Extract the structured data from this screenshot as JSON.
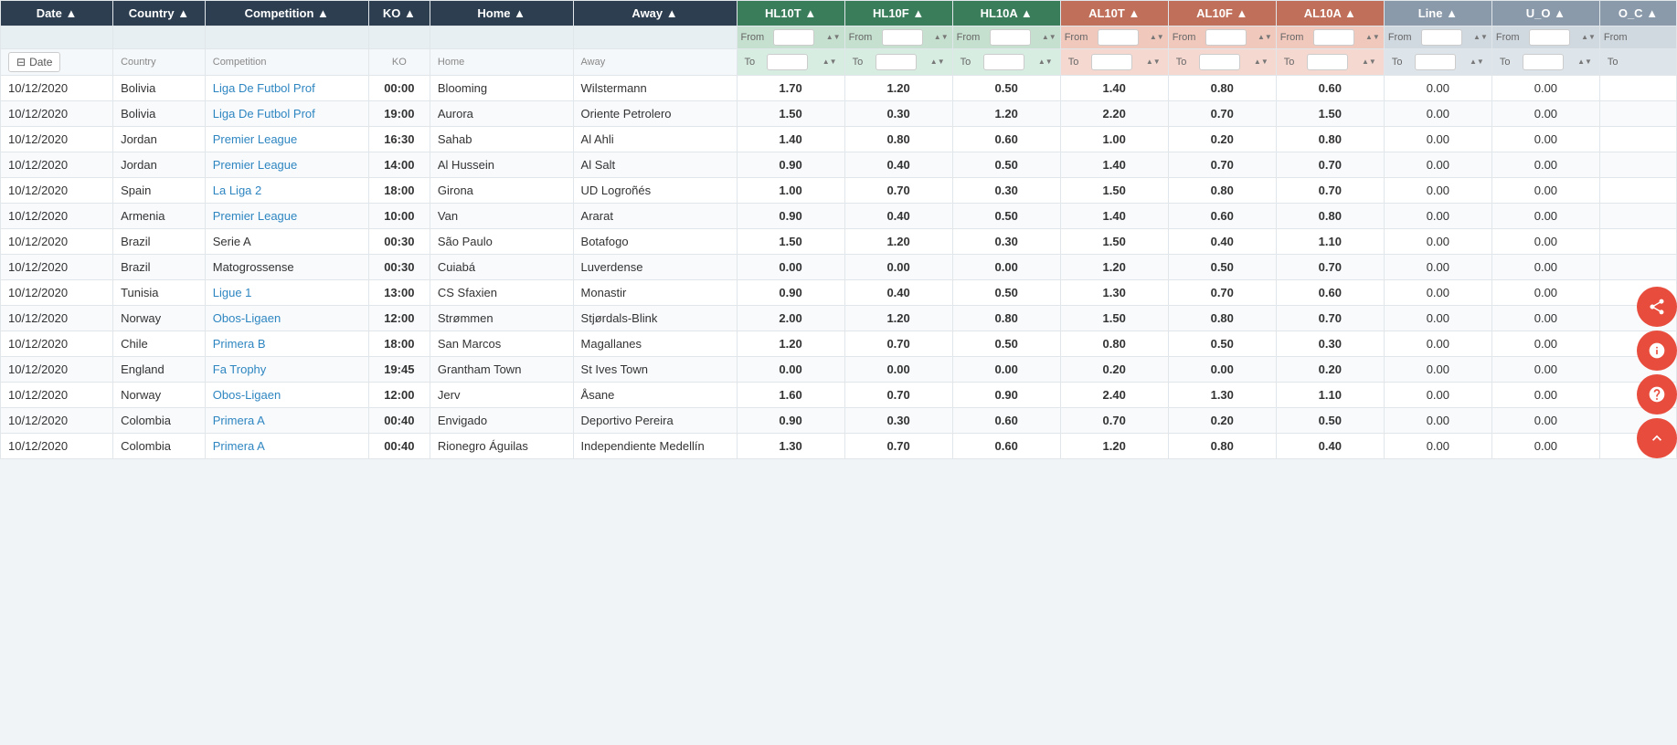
{
  "columns": {
    "date": "Date",
    "country": "Country",
    "competition": "Competition",
    "ko": "KO",
    "home": "Home",
    "away": "Away",
    "hl10t": "HL10T",
    "hl10f": "HL10F",
    "hl10a": "HL10A",
    "al10t": "AL10T",
    "al10f": "AL10F",
    "al10a": "AL10A",
    "line": "Line",
    "uo": "U_O",
    "oc": "O_C"
  },
  "filter_row": {
    "date_btn": "Date",
    "country_lbl": "Country",
    "competition_lbl": "Competition",
    "ko_lbl": "KO",
    "home_lbl": "Home",
    "away_lbl": "Away"
  },
  "from_label": "From",
  "to_label": "To",
  "rows": [
    {
      "date": "10/12/2020",
      "country": "Bolivia",
      "competition": "Liga De Futbol Prof",
      "competition_link": true,
      "ko": "00:00",
      "home": "Blooming",
      "away": "Wilstermann",
      "hl10t": "1.70",
      "hl10f": "1.20",
      "hl10a": "0.50",
      "al10t": "1.40",
      "al10f": "0.80",
      "al10a": "0.60",
      "line": "0.00",
      "uo": "0.00",
      "oc": "",
      "hl10t_class": "hl-dark",
      "hl10f_class": "hl-mid",
      "hl10a_class": "hl-vlight",
      "al10t_class": "al-light",
      "al10f_class": "al-vlight",
      "al10a_class": "al-zero"
    },
    {
      "date": "10/12/2020",
      "country": "Bolivia",
      "competition": "Liga De Futbol Prof",
      "competition_link": true,
      "ko": "19:00",
      "home": "Aurora",
      "away": "Oriente Petrolero",
      "hl10t": "1.50",
      "hl10f": "0.30",
      "hl10a": "1.20",
      "al10t": "2.20",
      "al10f": "0.70",
      "al10a": "1.50",
      "line": "0.00",
      "uo": "0.00",
      "oc": "",
      "hl10t_class": "hl-mid",
      "hl10f_class": "hl-vlight",
      "hl10a_class": "hl-mid",
      "al10t_class": "al-dark",
      "al10f_class": "al-vlight",
      "al10a_class": "al-mid"
    },
    {
      "date": "10/12/2020",
      "country": "Jordan",
      "competition": "Premier League",
      "competition_link": true,
      "ko": "16:30",
      "home": "Sahab",
      "away": "Al Ahli",
      "hl10t": "1.40",
      "hl10f": "0.80",
      "hl10a": "0.60",
      "al10t": "1.00",
      "al10f": "0.20",
      "al10a": "0.80",
      "line": "0.00",
      "uo": "0.00",
      "oc": "",
      "hl10t_class": "hl-light",
      "hl10f_class": "hl-vlight",
      "hl10a_class": "hl-vlight",
      "al10t_class": "al-vlight",
      "al10f_class": "al-zero",
      "al10a_class": "al-vlight"
    },
    {
      "date": "10/12/2020",
      "country": "Jordan",
      "competition": "Premier League",
      "competition_link": true,
      "ko": "14:00",
      "home": "Al Hussein",
      "away": "Al Salt",
      "hl10t": "0.90",
      "hl10f": "0.40",
      "hl10a": "0.50",
      "al10t": "1.40",
      "al10f": "0.70",
      "al10a": "0.70",
      "line": "0.00",
      "uo": "0.00",
      "oc": "",
      "hl10t_class": "hl-vlight",
      "hl10f_class": "hl-vlight",
      "hl10a_class": "hl-vlight",
      "al10t_class": "al-light",
      "al10f_class": "al-vlight",
      "al10a_class": "al-vlight"
    },
    {
      "date": "10/12/2020",
      "country": "Spain",
      "competition": "La Liga 2",
      "competition_link": true,
      "ko": "18:00",
      "home": "Girona",
      "away": "UD Logroñés",
      "hl10t": "1.00",
      "hl10f": "0.70",
      "hl10a": "0.30",
      "al10t": "1.50",
      "al10f": "0.80",
      "al10a": "0.70",
      "line": "0.00",
      "uo": "0.00",
      "oc": "",
      "hl10t_class": "hl-vlight",
      "hl10f_class": "hl-vlight",
      "hl10a_class": "hl-vlight",
      "al10t_class": "al-light",
      "al10f_class": "al-vlight",
      "al10a_class": "al-vlight"
    },
    {
      "date": "10/12/2020",
      "country": "Armenia",
      "competition": "Premier League",
      "competition_link": true,
      "ko": "10:00",
      "home": "Van",
      "away": "Ararat",
      "hl10t": "0.90",
      "hl10f": "0.40",
      "hl10a": "0.50",
      "al10t": "1.40",
      "al10f": "0.60",
      "al10a": "0.80",
      "line": "0.00",
      "uo": "0.00",
      "oc": "",
      "hl10t_class": "hl-vlight",
      "hl10f_class": "hl-vlight",
      "hl10a_class": "hl-vlight",
      "al10t_class": "al-light",
      "al10f_class": "al-vlight",
      "al10a_class": "al-vlight"
    },
    {
      "date": "10/12/2020",
      "country": "Brazil",
      "competition": "Serie A",
      "competition_link": false,
      "ko": "00:30",
      "home": "São Paulo",
      "away": "Botafogo",
      "hl10t": "1.50",
      "hl10f": "1.20",
      "hl10a": "0.30",
      "al10t": "1.50",
      "al10f": "0.40",
      "al10a": "1.10",
      "line": "0.00",
      "uo": "0.00",
      "oc": "",
      "hl10t_class": "hl-mid",
      "hl10f_class": "hl-mid",
      "hl10a_class": "hl-vlight",
      "al10t_class": "al-light",
      "al10f_class": "al-vlight",
      "al10a_class": "al-light"
    },
    {
      "date": "10/12/2020",
      "country": "Brazil",
      "competition": "Matogrossense",
      "competition_link": false,
      "ko": "00:30",
      "home": "Cuiabá",
      "away": "Luverdense",
      "hl10t": "0.00",
      "hl10f": "0.00",
      "hl10a": "0.00",
      "al10t": "1.20",
      "al10f": "0.50",
      "al10a": "0.70",
      "line": "0.00",
      "uo": "0.00",
      "oc": "",
      "hl10t_class": "hl-zero",
      "hl10f_class": "hl-zero",
      "hl10a_class": "hl-zero",
      "al10t_class": "al-vlight",
      "al10f_class": "al-vlight",
      "al10a_class": "al-vlight"
    },
    {
      "date": "10/12/2020",
      "country": "Tunisia",
      "competition": "Ligue 1",
      "competition_link": true,
      "ko": "13:00",
      "home": "CS Sfaxien",
      "away": "Monastir",
      "hl10t": "0.90",
      "hl10f": "0.40",
      "hl10a": "0.50",
      "al10t": "1.30",
      "al10f": "0.70",
      "al10a": "0.60",
      "line": "0.00",
      "uo": "0.00",
      "oc": "",
      "hl10t_class": "hl-vlight",
      "hl10f_class": "hl-vlight",
      "hl10a_class": "hl-vlight",
      "al10t_class": "al-light",
      "al10f_class": "al-vlight",
      "al10a_class": "al-vlight"
    },
    {
      "date": "10/12/2020",
      "country": "Norway",
      "competition": "Obos-Ligaen",
      "competition_link": true,
      "ko": "12:00",
      "home": "Strømmen",
      "away": "Stjørdals-Blink",
      "hl10t": "2.00",
      "hl10f": "1.20",
      "hl10a": "0.80",
      "al10t": "1.50",
      "al10f": "0.80",
      "al10a": "0.70",
      "line": "0.00",
      "uo": "0.00",
      "oc": "",
      "hl10t_class": "hl-dark",
      "hl10f_class": "hl-mid",
      "hl10a_class": "hl-vlight",
      "al10t_class": "al-light",
      "al10f_class": "al-vlight",
      "al10a_class": "al-vlight"
    },
    {
      "date": "10/12/2020",
      "country": "Chile",
      "competition": "Primera B",
      "competition_link": true,
      "ko": "18:00",
      "home": "San Marcos",
      "away": "Magallanes",
      "hl10t": "1.20",
      "hl10f": "0.70",
      "hl10a": "0.50",
      "al10t": "0.80",
      "al10f": "0.50",
      "al10a": "0.30",
      "line": "0.00",
      "uo": "0.00",
      "oc": "",
      "hl10t_class": "hl-light",
      "hl10f_class": "hl-vlight",
      "hl10a_class": "hl-vlight",
      "al10t_class": "al-vlight",
      "al10f_class": "al-vlight",
      "al10a_class": "al-zero"
    },
    {
      "date": "10/12/2020",
      "country": "England",
      "competition": "Fa Trophy",
      "competition_link": true,
      "ko": "19:45",
      "home": "Grantham Town",
      "away": "St Ives Town",
      "hl10t": "0.00",
      "hl10f": "0.00",
      "hl10a": "0.00",
      "al10t": "0.20",
      "al10f": "0.00",
      "al10a": "0.20",
      "line": "0.00",
      "uo": "0.00",
      "oc": "",
      "hl10t_class": "hl-zero",
      "hl10f_class": "hl-zero",
      "hl10a_class": "hl-zero",
      "al10t_class": "al-zero",
      "al10f_class": "al-zero",
      "al10a_class": "al-zero"
    },
    {
      "date": "10/12/2020",
      "country": "Norway",
      "competition": "Obos-Ligaen",
      "competition_link": true,
      "ko": "12:00",
      "home": "Jerv",
      "away": "Åsane",
      "hl10t": "1.60",
      "hl10f": "0.70",
      "hl10a": "0.90",
      "al10t": "2.40",
      "al10f": "1.30",
      "al10a": "1.10",
      "line": "0.00",
      "uo": "0.00",
      "oc": "",
      "hl10t_class": "hl-mid",
      "hl10f_class": "hl-vlight",
      "hl10a_class": "hl-vlight",
      "al10t_class": "al-dark",
      "al10f_class": "al-mid",
      "al10a_class": "al-light"
    },
    {
      "date": "10/12/2020",
      "country": "Colombia",
      "competition": "Primera A",
      "competition_link": true,
      "ko": "00:40",
      "home": "Envigado",
      "away": "Deportivo Pereira",
      "hl10t": "0.90",
      "hl10f": "0.30",
      "hl10a": "0.60",
      "al10t": "0.70",
      "al10f": "0.20",
      "al10a": "0.50",
      "line": "0.00",
      "uo": "0.00",
      "oc": "",
      "hl10t_class": "hl-vlight",
      "hl10f_class": "hl-vlight",
      "hl10a_class": "hl-vlight",
      "al10t_class": "al-vlight",
      "al10f_class": "al-zero",
      "al10a_class": "al-vlight"
    },
    {
      "date": "10/12/2020",
      "country": "Colombia",
      "competition": "Primera A",
      "competition_link": true,
      "ko": "00:40",
      "home": "Rionegro Águilas",
      "away": "Independiente Medellín",
      "hl10t": "1.30",
      "hl10f": "0.70",
      "hl10a": "0.60",
      "al10t": "1.20",
      "al10f": "0.80",
      "al10a": "0.40",
      "line": "0.00",
      "uo": "0.00",
      "oc": "",
      "hl10t_class": "hl-light",
      "hl10f_class": "hl-vlight",
      "hl10a_class": "hl-vlight",
      "al10t_class": "al-vlight",
      "al10f_class": "al-vlight",
      "al10a_class": "al-zero"
    }
  ],
  "side_buttons": {
    "share": "⤷",
    "info": "●",
    "help": "?",
    "up": "▲"
  }
}
